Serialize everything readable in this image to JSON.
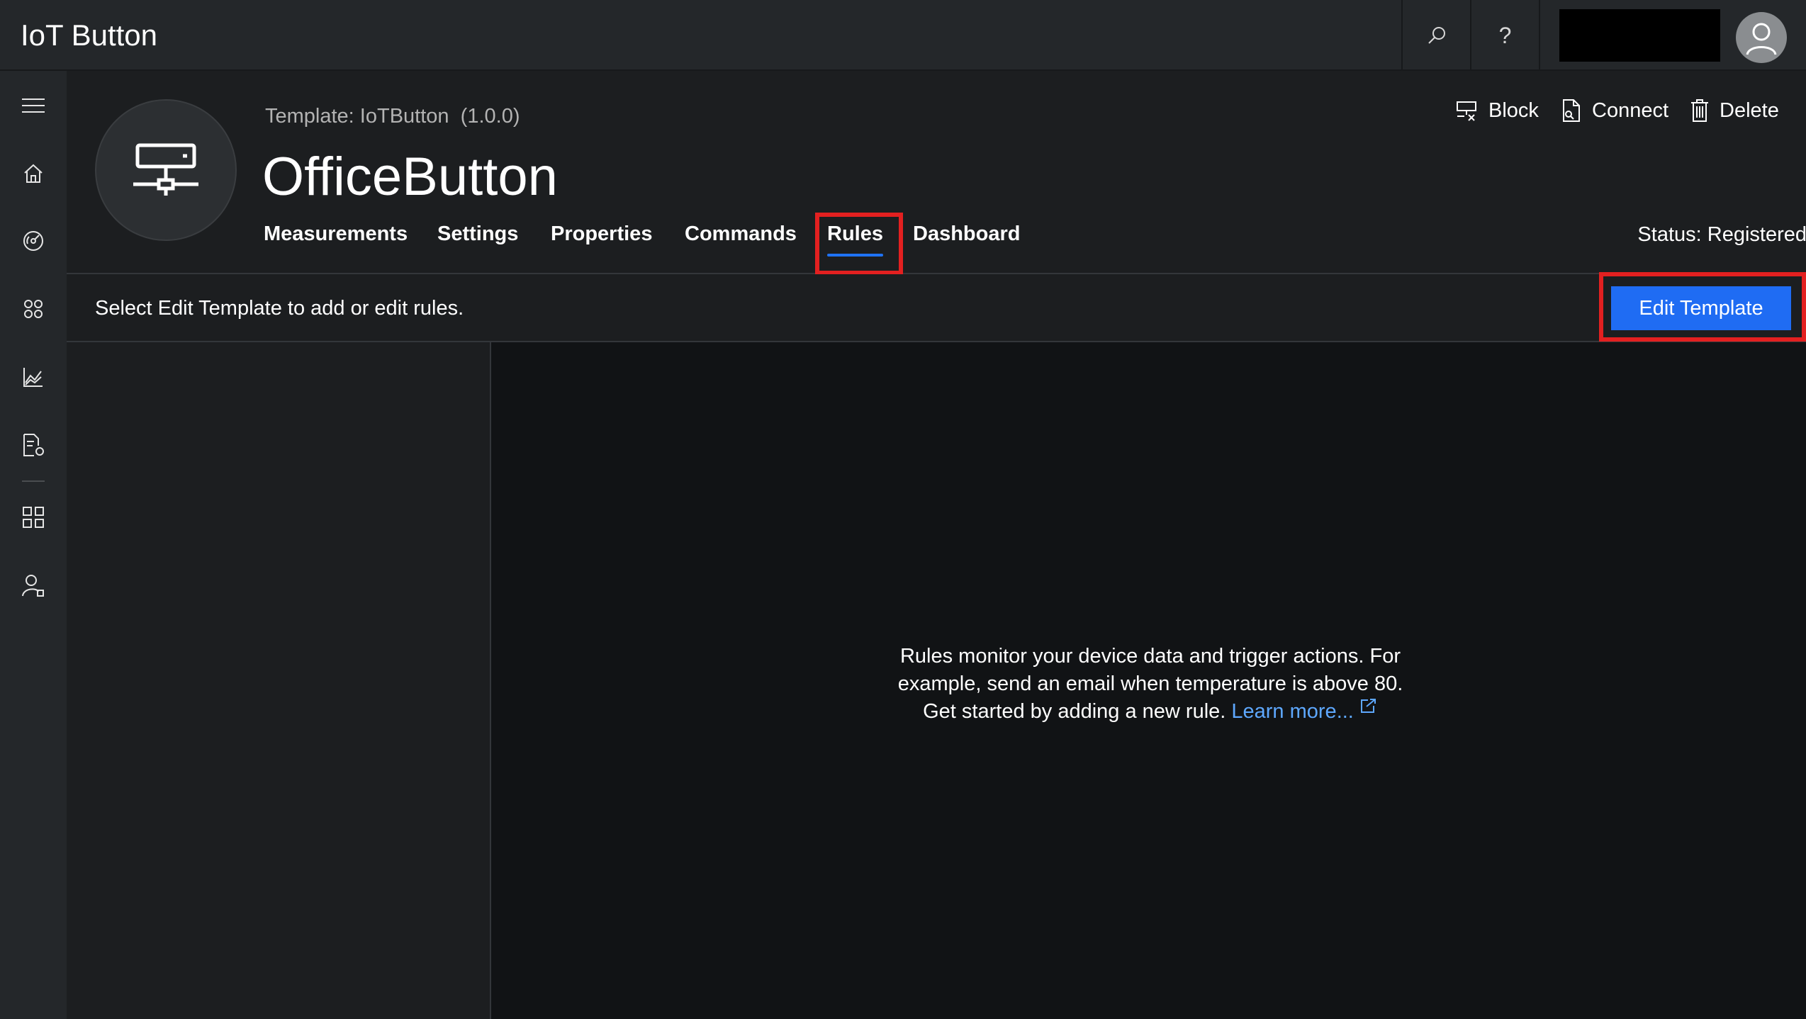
{
  "app": {
    "title": "IoT Button"
  },
  "topbar": {
    "search_icon": "search-icon",
    "help_icon": "help-icon",
    "help_glyph": "?",
    "avatar_icon": "user-avatar-icon"
  },
  "nav": {
    "items": [
      {
        "name": "menu",
        "icon": "hamburger-icon"
      },
      {
        "name": "home",
        "icon": "home-icon"
      },
      {
        "name": "device-explorer",
        "icon": "gauge-icon"
      },
      {
        "name": "device-sets",
        "icon": "device-sets-icon"
      },
      {
        "name": "analytics",
        "icon": "analytics-icon"
      },
      {
        "name": "jobs",
        "icon": "jobs-icon"
      },
      {
        "name": "app-builder",
        "icon": "app-builder-icon"
      },
      {
        "name": "administration",
        "icon": "admin-icon"
      }
    ]
  },
  "header": {
    "template_label": "Template:",
    "template_name": "IoTButton",
    "template_version": "(1.0.0)",
    "device_name": "OfficeButton",
    "device_icon": "device-icon",
    "status": "Status: Registered",
    "tabs": [
      {
        "label": "Measurements",
        "active": false
      },
      {
        "label": "Settings",
        "active": false
      },
      {
        "label": "Properties",
        "active": false
      },
      {
        "label": "Commands",
        "active": false
      },
      {
        "label": "Rules",
        "active": true
      },
      {
        "label": "Dashboard",
        "active": false
      }
    ],
    "actions": {
      "block": "Block",
      "connect": "Connect",
      "delete": "Delete"
    }
  },
  "toolbar": {
    "message": "Select Edit Template to add or edit rules.",
    "edit_button": "Edit Template"
  },
  "content": {
    "empty_text": "Rules monitor your device data and trigger actions. For example, send an email when temperature is above 80. Get started by adding a new rule.",
    "learn_more": "Learn more..."
  },
  "colors": {
    "accent": "#1f6cf3",
    "highlight": "#e32020",
    "link": "#5ea8ff"
  }
}
